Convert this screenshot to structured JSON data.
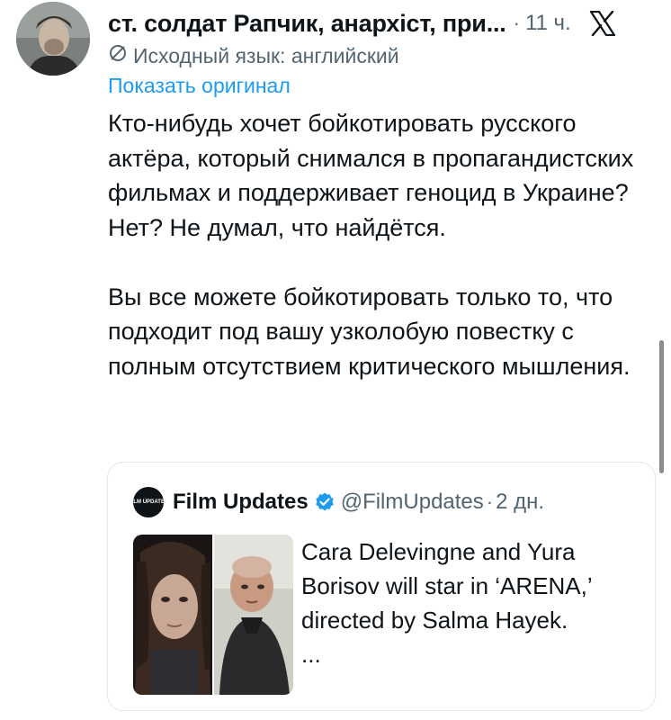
{
  "tweet": {
    "author_name": "ст. солдат Рапчик, анархіст, при...",
    "separator": "·",
    "timestamp": "11 ч.",
    "translation_label": "Исходный язык: английский",
    "show_original_label": "Показать оригинал",
    "paragraphs": [
      "Кто-нибудь хочет бойкотировать русского актёра, который снимался в пропагандистских фильмах и поддерживает геноцид в Украине? Нет? Не думал, что найдётся.",
      "Вы все можете бойкотировать только то, что подходит под вашу узколобую повестку с полным отсутствием критического мышления."
    ]
  },
  "quote": {
    "avatar_text": "FILM UPDATES",
    "name": "Film Updates",
    "handle": "@FilmUpdates",
    "separator": "·",
    "time": "2 дн.",
    "text": "Cara Delevingne and Yura Borisov will star in ‘ARENA,’ directed by Salma Hayek.",
    "ellipsis": "..."
  },
  "colors": {
    "link": "#1d9bf0",
    "secondary_text": "#536471",
    "verified": "#1d9bf0"
  },
  "icons": [
    "x-logo-icon",
    "translate-icon",
    "verified-badge-icon"
  ]
}
